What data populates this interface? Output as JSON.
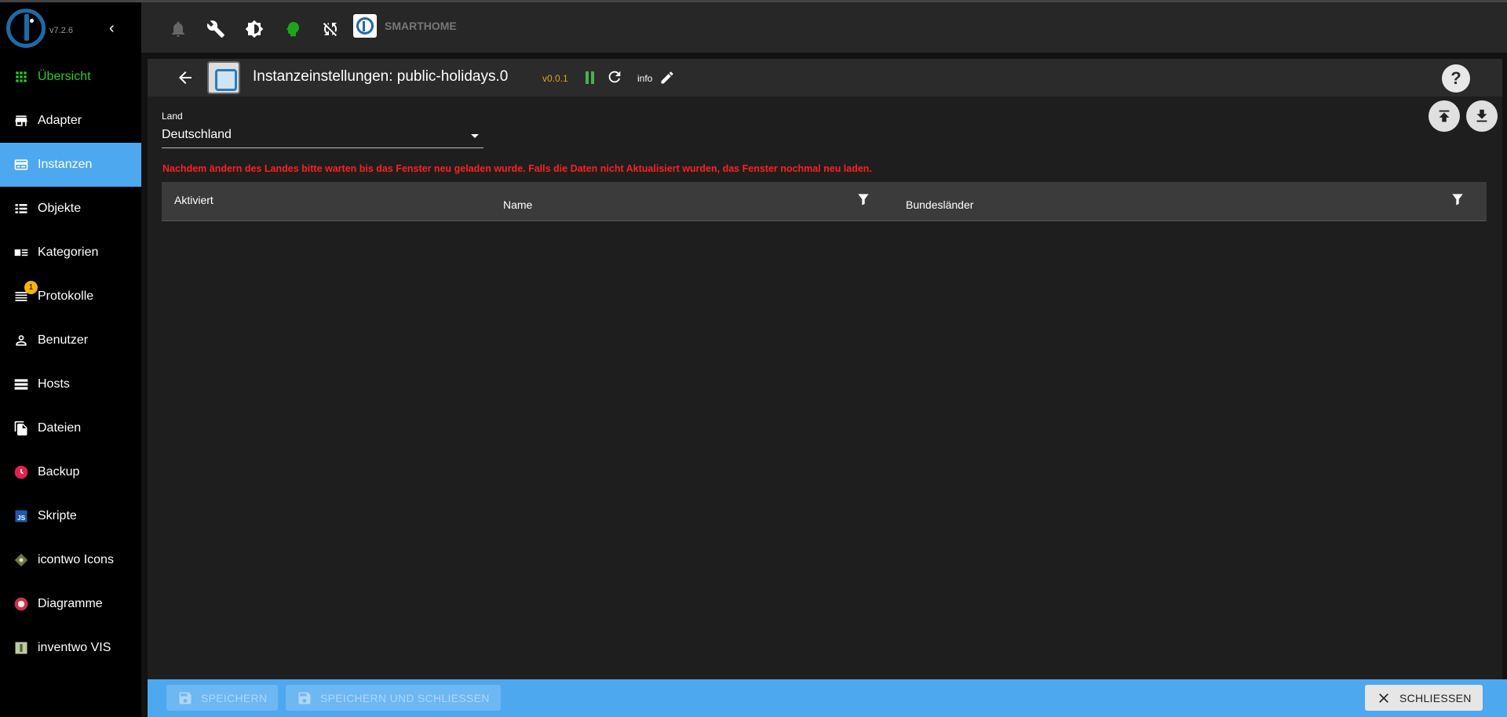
{
  "app": {
    "version": "v7.2.6"
  },
  "sidebar": {
    "items": [
      {
        "label": "Übersicht",
        "icon": "grid-icon"
      },
      {
        "label": "Adapter",
        "icon": "store-icon"
      },
      {
        "label": "Instanzen",
        "icon": "instances-icon"
      },
      {
        "label": "Objekte",
        "icon": "list-icon"
      },
      {
        "label": "Kategorien",
        "icon": "categories-icon"
      },
      {
        "label": "Protokolle",
        "icon": "log-icon",
        "badge": "1"
      },
      {
        "label": "Benutzer",
        "icon": "user-icon"
      },
      {
        "label": "Hosts",
        "icon": "hosts-icon"
      },
      {
        "label": "Dateien",
        "icon": "files-icon"
      },
      {
        "label": "Backup",
        "icon": "backup-icon"
      },
      {
        "label": "Skripte",
        "icon": "javascript-icon"
      },
      {
        "label": "icontwo Icons",
        "icon": "icontwo-icon"
      },
      {
        "label": "Diagramme",
        "icon": "charts-icon"
      },
      {
        "label": "inventwo VIS",
        "icon": "inventwo-icon"
      }
    ],
    "active": "Instanzen"
  },
  "toolbar": {
    "title": "SMARTHOME"
  },
  "panel": {
    "title": "Instanzeinstellungen: public-holidays.0",
    "version": "v0.0.1",
    "info_label": "info",
    "help_label": "?",
    "land_label": "Land",
    "land_value": "Deutschland",
    "warning": "Nachdem ändern des Landes bitte warten bis das Fenster neu geladen wurde. Falls die Daten nicht Aktualisiert wurden, das Fenster nochmal neu laden.",
    "table": {
      "columns": [
        "Aktiviert",
        "Name",
        "Bundesländer"
      ]
    }
  },
  "footer": {
    "save_label": "SPEICHERN",
    "save_close_label": "SPEICHERN UND SCHLIESSEN",
    "close_label": "SCHLIESSEN"
  },
  "colors": {
    "accent": "#4ea8ef",
    "active_green": "#2ec92e",
    "warning": "#ff1f1f",
    "version": "#e0a020"
  }
}
